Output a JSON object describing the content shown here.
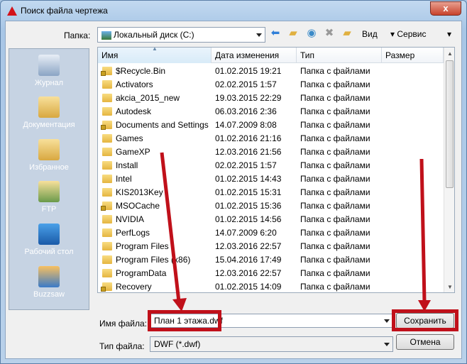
{
  "window": {
    "title": "Поиск файла чертежа",
    "close": "x"
  },
  "toolbar": {
    "folder_label": "Папка:",
    "folder_value": "Локальный диск (C:)",
    "view": "Вид",
    "service": "Сервис"
  },
  "sidebar": {
    "items": [
      {
        "label": "Журнал"
      },
      {
        "label": "Документация"
      },
      {
        "label": "Избранное"
      },
      {
        "label": "FTP"
      },
      {
        "label": "Рабочий стол"
      },
      {
        "label": "Buzzsaw"
      }
    ]
  },
  "columns": [
    "Имя",
    "Дата изменения",
    "Тип",
    "Размер"
  ],
  "files": [
    {
      "name": "$Recycle.Bin",
      "date": "01.02.2015 19:21",
      "type": "Папка с файлами",
      "locked": true
    },
    {
      "name": "Activators",
      "date": "02.02.2015 1:57",
      "type": "Папка с файлами",
      "locked": false
    },
    {
      "name": "akcia_2015_new",
      "date": "19.03.2015 22:29",
      "type": "Папка с файлами",
      "locked": false
    },
    {
      "name": "Autodesk",
      "date": "06.03.2016 2:36",
      "type": "Папка с файлами",
      "locked": false
    },
    {
      "name": "Documents and Settings",
      "date": "14.07.2009 8:08",
      "type": "Папка с файлами",
      "locked": true
    },
    {
      "name": "Games",
      "date": "01.02.2016 21:16",
      "type": "Папка с файлами",
      "locked": false
    },
    {
      "name": "GameXP",
      "date": "12.03.2016 21:56",
      "type": "Папка с файлами",
      "locked": false
    },
    {
      "name": "Install",
      "date": "02.02.2015 1:57",
      "type": "Папка с файлами",
      "locked": false
    },
    {
      "name": "Intel",
      "date": "01.02.2015 14:43",
      "type": "Папка с файлами",
      "locked": false
    },
    {
      "name": "KIS2013Key",
      "date": "01.02.2015 15:31",
      "type": "Папка с файлами",
      "locked": false
    },
    {
      "name": "MSOCache",
      "date": "01.02.2015 15:36",
      "type": "Папка с файлами",
      "locked": true
    },
    {
      "name": "NVIDIA",
      "date": "01.02.2015 14:56",
      "type": "Папка с файлами",
      "locked": false
    },
    {
      "name": "PerfLogs",
      "date": "14.07.2009 6:20",
      "type": "Папка с файлами",
      "locked": false
    },
    {
      "name": "Program Files",
      "date": "12.03.2016 22:57",
      "type": "Папка с файлами",
      "locked": false
    },
    {
      "name": "Program Files (x86)",
      "date": "15.04.2016 17:49",
      "type": "Папка с файлами",
      "locked": false
    },
    {
      "name": "ProgramData",
      "date": "12.03.2016 22:57",
      "type": "Папка с файлами",
      "locked": false
    },
    {
      "name": "Recovery",
      "date": "01.02.2015 14:09",
      "type": "Папка с файлами",
      "locked": true
    }
  ],
  "bottom": {
    "filename_label": "Имя файла:",
    "filename_value": "План 1 этажа.dwf",
    "filetype_label": "Тип файла:",
    "filetype_value": "DWF (*.dwf)",
    "save": "Сохранить",
    "cancel": "Отмена"
  },
  "colors": {
    "annotation": "#c0101a",
    "sidebar": "#c6d3e3"
  }
}
